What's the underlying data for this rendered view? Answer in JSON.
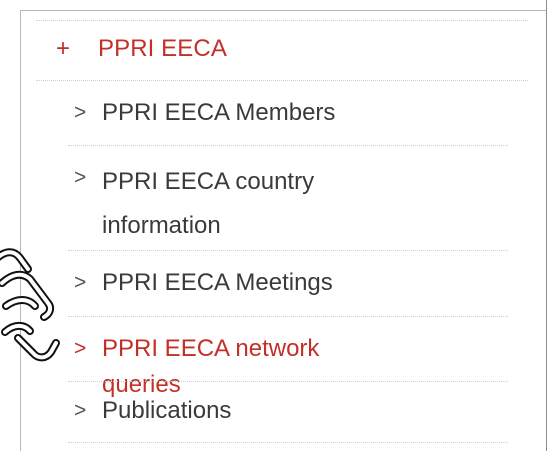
{
  "menu": {
    "header": {
      "prefix": "+",
      "label": "PPRI EECA"
    },
    "items": [
      {
        "chevron": ">",
        "label": "PPRI EECA Members",
        "active": false
      },
      {
        "chevron": ">",
        "label": "PPRI EECA country information",
        "active": false
      },
      {
        "chevron": ">",
        "label": "PPRI EECA Meetings",
        "active": false
      },
      {
        "chevron": ">",
        "label": "PPRI EECA network queries",
        "active": true
      },
      {
        "chevron": ">",
        "label": "Publications",
        "active": false
      }
    ]
  },
  "colors": {
    "accent": "#c23028",
    "text": "#3a3a3a",
    "divider": "#cfcfcf"
  },
  "icons": {
    "cursor": "hand-pointer-cursor-icon"
  }
}
